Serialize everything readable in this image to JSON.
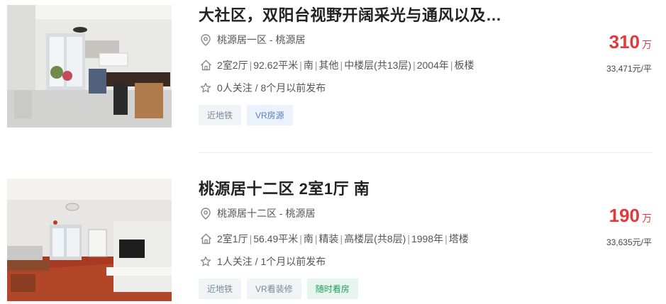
{
  "listings": [
    {
      "title": "大社区，双阳台视野开阔采光与通风以及…",
      "location": "桃源居一区 - 桃源居",
      "info": [
        "2室2厅",
        "92.62平米",
        "南",
        "其他",
        "中楼层(共13层)",
        "2004年",
        "板楼"
      ],
      "follow": "0人关注 / 8个月以前发布",
      "tags": [
        {
          "label": "近地铁",
          "style": "gray"
        },
        {
          "label": "VR房源",
          "style": "blue"
        }
      ],
      "price": "310",
      "price_unit": "万",
      "unit_price": "33,471元/平",
      "icons": {
        "location": "location-pin-icon",
        "house": "house-icon",
        "follow": "star-icon"
      }
    },
    {
      "title": "桃源居十二区 2室1厅 南",
      "location": "桃源居十二区 - 桃源居",
      "info": [
        "2室1厅",
        "56.49平米",
        "南",
        "精装",
        "高楼层(共8层)",
        "1998年",
        "塔楼"
      ],
      "follow": "1人关注 / 1个月以前发布",
      "tags": [
        {
          "label": "近地铁",
          "style": "gray"
        },
        {
          "label": "VR看装修",
          "style": "gray"
        },
        {
          "label": "随时看房",
          "style": "green"
        }
      ],
      "price": "190",
      "price_unit": "万",
      "unit_price": "33,635元/平",
      "icons": {
        "location": "location-pin-icon",
        "house": "house-icon",
        "follow": "star-icon"
      }
    }
  ],
  "colors": {
    "price": "#e4393c",
    "tag_green": "#1e9b5a",
    "tag_blue": "#5a7fb5"
  }
}
